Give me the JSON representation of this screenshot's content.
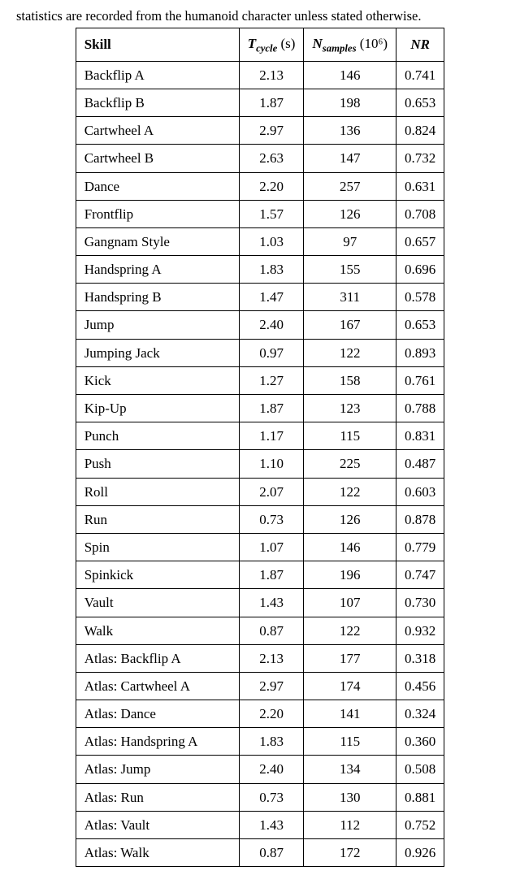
{
  "caption": "statistics are recorded from the humanoid character unless stated otherwise.",
  "headers": {
    "skill": "Skill",
    "tcycle_T": "T",
    "tcycle_sub": "cycle",
    "tcycle_unit": "(s)",
    "nsamples_N": "N",
    "nsamples_sub": "samples",
    "nsamples_unit": "(10⁶)",
    "nr": "NR"
  },
  "rows": [
    {
      "skill": "Backflip A",
      "tcycle": "2.13",
      "nsamples": "146",
      "nr": "0.741"
    },
    {
      "skill": "Backflip B",
      "tcycle": "1.87",
      "nsamples": "198",
      "nr": "0.653"
    },
    {
      "skill": "Cartwheel A",
      "tcycle": "2.97",
      "nsamples": "136",
      "nr": "0.824"
    },
    {
      "skill": "Cartwheel B",
      "tcycle": "2.63",
      "nsamples": "147",
      "nr": "0.732"
    },
    {
      "skill": "Dance",
      "tcycle": "2.20",
      "nsamples": "257",
      "nr": "0.631"
    },
    {
      "skill": "Frontflip",
      "tcycle": "1.57",
      "nsamples": "126",
      "nr": "0.708"
    },
    {
      "skill": "Gangnam Style",
      "tcycle": "1.03",
      "nsamples": "97",
      "nr": "0.657"
    },
    {
      "skill": "Handspring A",
      "tcycle": "1.83",
      "nsamples": "155",
      "nr": "0.696"
    },
    {
      "skill": "Handspring B",
      "tcycle": "1.47",
      "nsamples": "311",
      "nr": "0.578"
    },
    {
      "skill": "Jump",
      "tcycle": "2.40",
      "nsamples": "167",
      "nr": "0.653"
    },
    {
      "skill": "Jumping Jack",
      "tcycle": "0.97",
      "nsamples": "122",
      "nr": "0.893"
    },
    {
      "skill": "Kick",
      "tcycle": "1.27",
      "nsamples": "158",
      "nr": "0.761"
    },
    {
      "skill": "Kip-Up",
      "tcycle": "1.87",
      "nsamples": "123",
      "nr": "0.788"
    },
    {
      "skill": "Punch",
      "tcycle": "1.17",
      "nsamples": "115",
      "nr": "0.831"
    },
    {
      "skill": "Push",
      "tcycle": "1.10",
      "nsamples": "225",
      "nr": "0.487"
    },
    {
      "skill": "Roll",
      "tcycle": "2.07",
      "nsamples": "122",
      "nr": "0.603"
    },
    {
      "skill": "Run",
      "tcycle": "0.73",
      "nsamples": "126",
      "nr": "0.878"
    },
    {
      "skill": "Spin",
      "tcycle": "1.07",
      "nsamples": "146",
      "nr": "0.779"
    },
    {
      "skill": "Spinkick",
      "tcycle": "1.87",
      "nsamples": "196",
      "nr": "0.747"
    },
    {
      "skill": "Vault",
      "tcycle": "1.43",
      "nsamples": "107",
      "nr": "0.730"
    },
    {
      "skill": "Walk",
      "tcycle": "0.87",
      "nsamples": "122",
      "nr": "0.932"
    },
    {
      "skill": "Atlas: Backflip A",
      "tcycle": "2.13",
      "nsamples": "177",
      "nr": "0.318"
    },
    {
      "skill": "Atlas: Cartwheel A",
      "tcycle": "2.97",
      "nsamples": "174",
      "nr": "0.456"
    },
    {
      "skill": "Atlas: Dance",
      "tcycle": "2.20",
      "nsamples": "141",
      "nr": "0.324"
    },
    {
      "skill": "Atlas: Handspring A",
      "tcycle": "1.83",
      "nsamples": "115",
      "nr": "0.360"
    },
    {
      "skill": "Atlas: Jump",
      "tcycle": "2.40",
      "nsamples": "134",
      "nr": "0.508"
    },
    {
      "skill": "Atlas: Run",
      "tcycle": "0.73",
      "nsamples": "130",
      "nr": "0.881"
    },
    {
      "skill": "Atlas: Vault",
      "tcycle": "1.43",
      "nsamples": "112",
      "nr": "0.752"
    },
    {
      "skill": "Atlas: Walk",
      "tcycle": "0.87",
      "nsamples": "172",
      "nr": "0.926"
    }
  ]
}
